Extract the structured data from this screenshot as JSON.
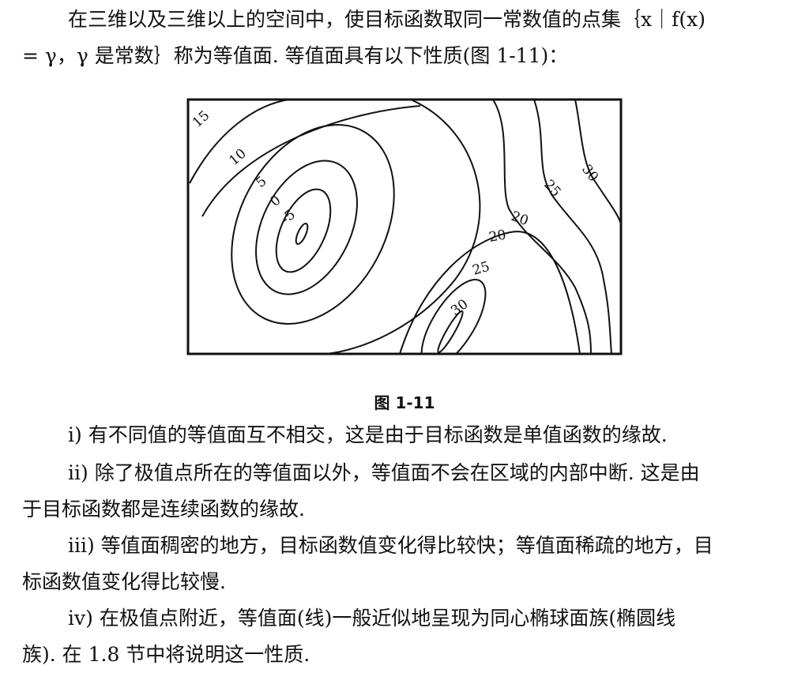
{
  "intro": {
    "line1": "在三维以及三维以上的空间中，使目标函数取同一常数值的点集｛x｜f(x)",
    "line2": "= γ，γ 是常数｝称为等值面. 等值面具有以下性质(图 1-11)："
  },
  "figure": {
    "caption": "图 1-11",
    "contour_labels": [
      "15",
      "10",
      "5",
      "0",
      "-5",
      "30",
      "25",
      "20",
      "20",
      "25",
      "30"
    ]
  },
  "properties": {
    "p1": "ⅰ) 有不同值的等值面互不相交，这是由于目标函数是单值函数的缘故.",
    "p2_line1": "ⅱ) 除了极值点所在的等值面以外，等值面不会在区域的内部中断. 这是由",
    "p2_line2": "于目标函数都是连续函数的缘故.",
    "p3_line1": "ⅲ) 等值面稠密的地方，目标函数值变化得比较快；等值面稀疏的地方，目",
    "p3_line2": "标函数值变化得比较慢.",
    "p4_line1": "ⅳ) 在极值点附近，等值面(线)一般近似地呈现为同心椭球面族(椭圆线",
    "p4_line2": "族). 在 1.8 节中将说明这一性质."
  }
}
